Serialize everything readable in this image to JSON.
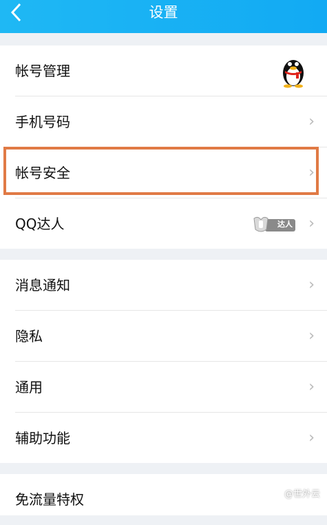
{
  "header": {
    "title": "设置",
    "back_icon": "back-chevron-icon"
  },
  "group1": {
    "items": [
      {
        "label": "帐号管理"
      },
      {
        "label": "手机号码"
      },
      {
        "label": "帐号安全"
      },
      {
        "label": "QQ达人",
        "badge": "达人"
      }
    ]
  },
  "group2": {
    "items": [
      {
        "label": "消息通知"
      },
      {
        "label": "隐私"
      },
      {
        "label": "通用"
      },
      {
        "label": "辅助功能"
      }
    ]
  },
  "group3": {
    "items": [
      {
        "label": "免流量特权"
      }
    ]
  },
  "chevron": "›",
  "watermark": {
    "text": "@世外云"
  },
  "colors": {
    "header": "#12aaf3",
    "highlight": "#e07a45",
    "chevron": "#b9b9b9"
  }
}
